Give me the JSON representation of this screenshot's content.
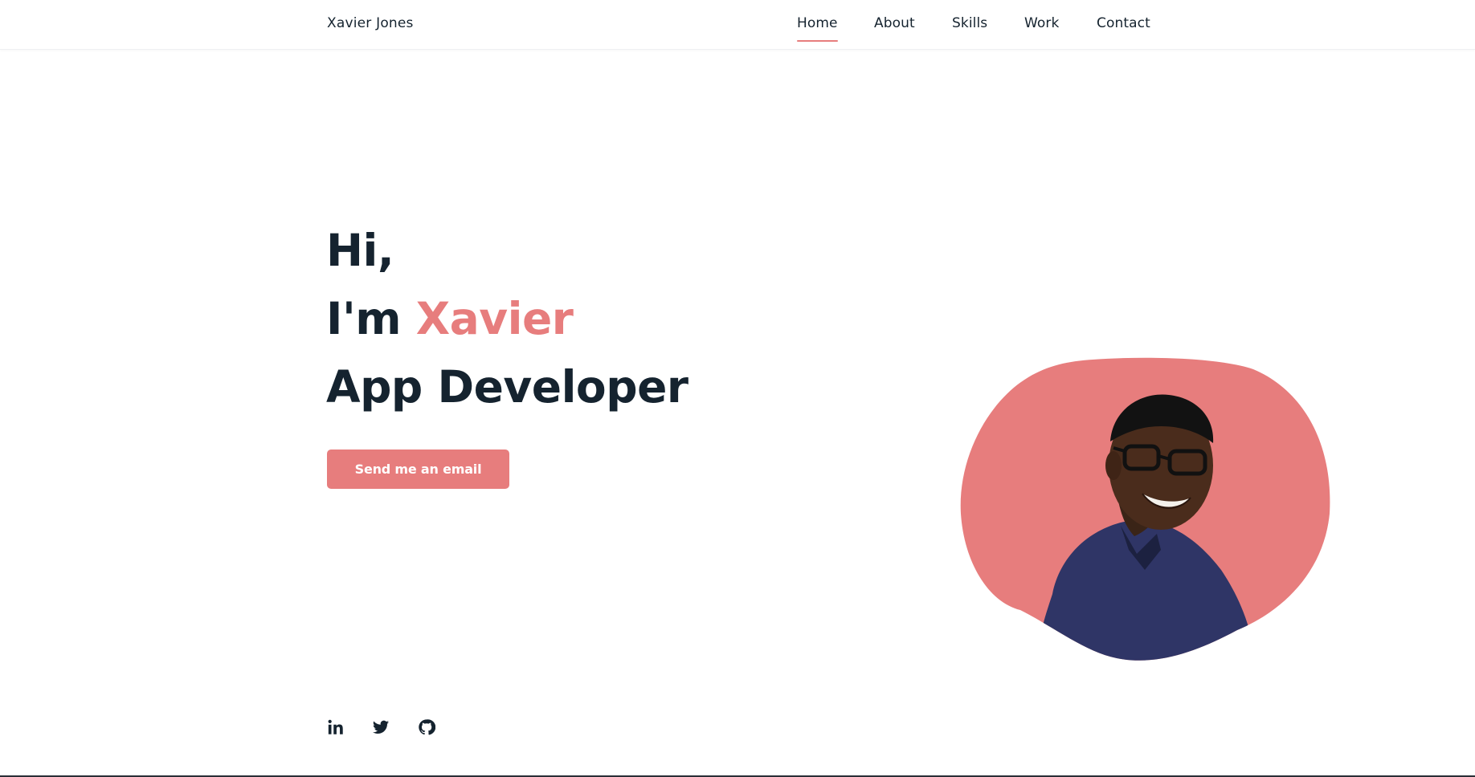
{
  "header": {
    "logo": "Xavier Jones",
    "nav": [
      {
        "label": "Home",
        "active": true
      },
      {
        "label": "About",
        "active": false
      },
      {
        "label": "Skills",
        "active": false
      },
      {
        "label": "Work",
        "active": false
      },
      {
        "label": "Contact",
        "active": false
      }
    ]
  },
  "hero": {
    "line1": "Hi,",
    "line2_prefix": "I'm ",
    "line2_name": "Xavier",
    "line3": "App Developer",
    "button_label": "Send me an email",
    "image_icon": "person-portrait"
  },
  "social": [
    {
      "icon": "linkedin-icon"
    },
    {
      "icon": "twitter-icon"
    },
    {
      "icon": "github-icon"
    }
  ],
  "colors": {
    "accent": "#e77d7d",
    "text": "#15232f",
    "background": "#ffffff"
  }
}
